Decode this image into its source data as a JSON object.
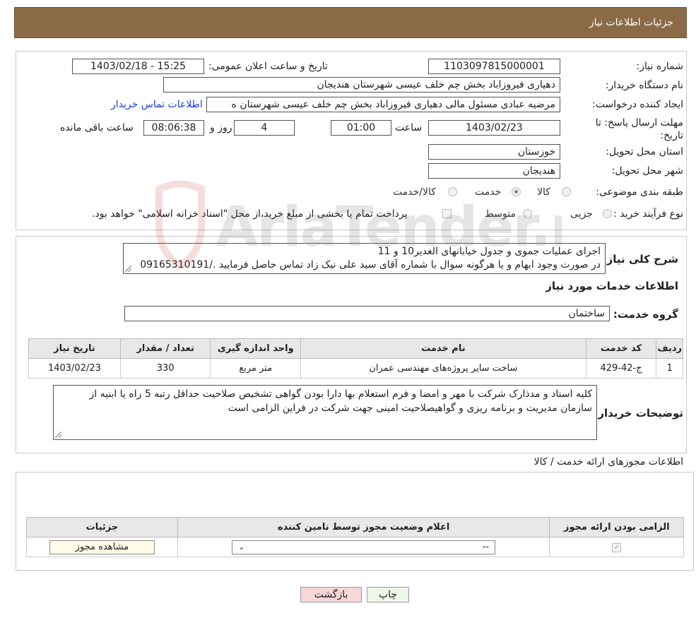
{
  "header": {
    "title": "جزئیات اطلاعات نیاز"
  },
  "info": {
    "need_number_label": "شماره نیاز:",
    "need_number": "1103097815000001",
    "announce_label": "تاریخ و ساعت اعلان عمومی:",
    "announce_value": "1403/02/18 - 15:25",
    "buyer_label": "نام دستگاه خریدار:",
    "buyer_value": "دهیاری فیروزاباد بخش چم خلف عیسی شهرستان هندیجان",
    "creator_label": "ایجاد کننده درخواست:",
    "creator_value": "مرضیه عبادی مسئول مالی دهیاری فیروزاباد بخش چم خلف عیسی شهرستان ه",
    "contact_link": "اطلاعات تماس خریدار",
    "deadline_label": "مهلت ارسال پاسخ: تا تاریخ:",
    "deadline_date": "1403/02/23",
    "time_label": "ساعت",
    "deadline_time": "01:00",
    "days_value": "4",
    "days_label": "روز و",
    "remaining_time": "08:06:38",
    "remaining_label": "ساعت باقی مانده",
    "province_label": "استان محل تحویل:",
    "province_value": "خوزستان",
    "city_label": "شهر محل تحویل:",
    "city_value": "هندیجان",
    "category_label": "طبقه بندی موضوعی:",
    "category_options": [
      "کالا",
      "خدمت",
      "کالا/خدمت"
    ],
    "process_label": "نوع فرآیند خرید :",
    "process_options": [
      "جزیی",
      "متوسط"
    ],
    "process_note": "پرداخت تمام یا بخشی از مبلغ خرید،از محل \"اسناد خزانه اسلامی\" خواهد بود."
  },
  "summary": {
    "label": "شرح کلی نیاز:",
    "line1": "اجرای عملیات جموی و جدول خیابانهای الغدیر10 و 11",
    "line2": "در صورت وجود ابهام و یا هرگونه سوال با شماره  آقای سید علی نیک زاد تماس حاصل فرمایید ./09165310191"
  },
  "services": {
    "section_title": "اطلاعات خدمات مورد نیاز",
    "group_label": "گروه خدمت:",
    "group_value": "ساختمان",
    "columns": [
      "ردیف",
      "کد خدمت",
      "نام خدمت",
      "واحد اندازه گیری",
      "تعداد / مقدار",
      "تاریخ نیاز"
    ],
    "rows": [
      [
        "1",
        "ج-42-429",
        "ساخت سایر پروژه‌های مهندسی عمران",
        "متر مربع",
        "330",
        "1403/02/23"
      ]
    ]
  },
  "buyer_notes": {
    "label": "توضیحات خریدار:",
    "text": "کلیه اسناد و مدذارک شرکت با مهر و امضا و فرم استعلام بها دارا بودن گواهی تشخیص صلاحیت حداقل رتبه 5 راه یا ابنیه از سازمان مدیریت و برنامه ریزی و گواهیصلاحیت امینی جهت شرکت در فراین الزامی است"
  },
  "permits": {
    "section_title": "اطلاعات مجوزهای ارائه خدمت / کالا",
    "columns": [
      "الزامی بودن ارائه مجوز",
      "اعلام وضعیت مجوز توسط نامین کننده",
      "جزئیات"
    ],
    "select_value": "--",
    "view_button": "مشاهده مجوز"
  },
  "buttons": {
    "print": "چاپ",
    "back": "بازگشت"
  },
  "watermark": {
    "text": "AriaTender.net"
  },
  "colors": {
    "header": "#8b6a47",
    "link": "#1a3fd6",
    "back_btn": "#f7d7d7",
    "print_btn": "#eef7e8"
  }
}
